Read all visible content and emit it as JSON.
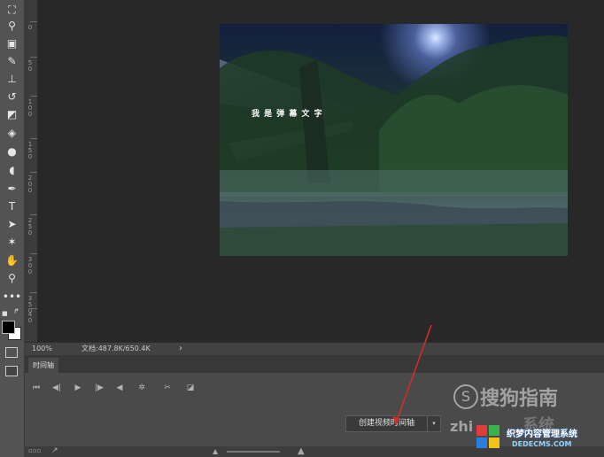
{
  "tools": [
    {
      "name": "crop-icon",
      "glyph": "⛶"
    },
    {
      "name": "eyedropper-icon",
      "glyph": "⚲"
    },
    {
      "name": "healing-brush-icon",
      "glyph": "▣"
    },
    {
      "name": "brush-icon",
      "glyph": "✎"
    },
    {
      "name": "clone-stamp-icon",
      "glyph": "⊥"
    },
    {
      "name": "history-brush-icon",
      "glyph": "↺"
    },
    {
      "name": "eraser-icon",
      "glyph": "◩"
    },
    {
      "name": "paint-bucket-icon",
      "glyph": "◈"
    },
    {
      "name": "blur-icon",
      "glyph": "●"
    },
    {
      "name": "dodge-icon",
      "glyph": "◖"
    },
    {
      "name": "pen-icon",
      "glyph": "✒"
    },
    {
      "name": "type-icon",
      "glyph": "T"
    },
    {
      "name": "path-selection-icon",
      "glyph": "➤"
    },
    {
      "name": "shape-icon",
      "glyph": "✶"
    },
    {
      "name": "hand-icon",
      "glyph": "✋"
    },
    {
      "name": "zoom-icon",
      "glyph": "⚲"
    },
    {
      "name": "more-tools-icon",
      "glyph": "•••"
    }
  ],
  "ruler": {
    "labels": [
      "0",
      "5 0",
      "1 0 0",
      "1 5 0",
      "2 0 0",
      "2 5 0",
      "3 0 0",
      "3 5 0",
      "4 0"
    ]
  },
  "image": {
    "overlay_text": "我 是 弹 幕 文 字"
  },
  "status": {
    "zoom": "100%",
    "doc": "文档:487.8K/650.4K",
    "arrow": "›"
  },
  "timeline": {
    "tab_label": "时间轴",
    "controls": [
      {
        "name": "first-frame-icon",
        "glyph": "⏮"
      },
      {
        "name": "previous-frame-icon",
        "glyph": "◀|"
      },
      {
        "name": "play-icon",
        "glyph": "▶"
      },
      {
        "name": "next-frame-icon",
        "glyph": "|▶"
      },
      {
        "name": "audio-icon",
        "glyph": "◀"
      },
      {
        "name": "settings-icon",
        "glyph": "✲"
      },
      {
        "name": "scissors-icon",
        "glyph": "✂"
      },
      {
        "name": "transition-icon",
        "glyph": "◪"
      }
    ],
    "create_button": "创建视频时间轴",
    "dropdown": "▾"
  },
  "watermarks": {
    "sogou": "搜狗指南",
    "sogou_logo": "S",
    "zhinan": "zhi",
    "xitong": "系统",
    "site_cn": "织梦内容管理系统",
    "site_en": "DEDECMS.COM"
  },
  "colors": {
    "toolbar_bg": "#535353",
    "canvas_bg": "#282828",
    "panel_bg": "#4a4a4a",
    "arrow_red": "#d62c2c"
  }
}
